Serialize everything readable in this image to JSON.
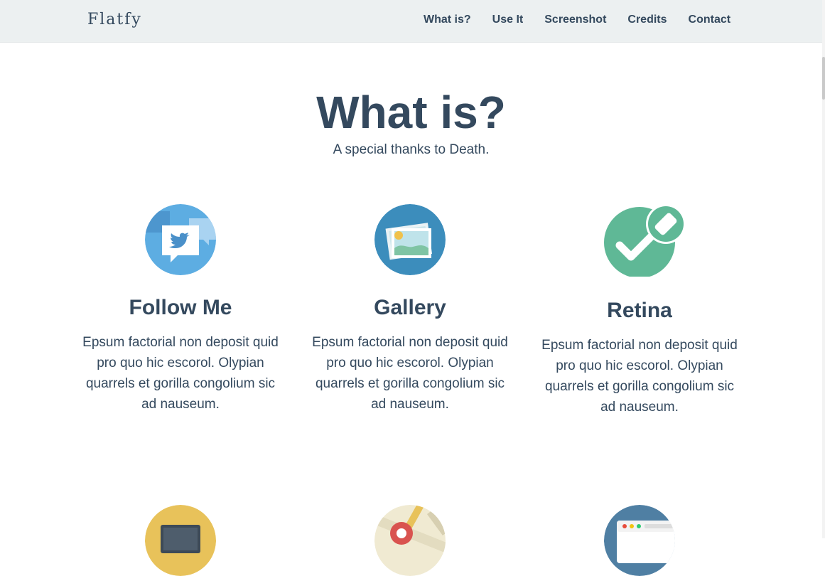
{
  "header": {
    "brand": "Flatfy",
    "nav": [
      "What is?",
      "Use It",
      "Screenshot",
      "Credits",
      "Contact"
    ]
  },
  "section": {
    "title": "What is?",
    "subtitle": "A special thanks to Death."
  },
  "features": [
    {
      "icon": "twitter-bubble-icon",
      "title": "Follow Me",
      "text": "Epsum factorial non deposit quid pro quo hic escorol. Olypian quarrels et gorilla congolium sic ad nauseum."
    },
    {
      "icon": "gallery-photo-icon",
      "title": "Gallery",
      "text": "Epsum factorial non deposit quid pro quo hic escorol. Olypian quarrels et gorilla congolium sic ad nauseum."
    },
    {
      "icon": "checkmark-eraser-icon",
      "title": "Retina",
      "text": "Epsum factorial non deposit quid pro quo hic escorol. Olypian quarrels et gorilla congolium sic ad nauseum."
    }
  ],
  "features_row2_icons": [
    "monitor-icon",
    "map-pin-icon",
    "browser-window-icon"
  ],
  "colors": {
    "nav_bg": "#ecf0f1",
    "text": "#34495e",
    "twitter_blue": "#5dade2",
    "gallery_blue": "#3c8dbc",
    "retina_green": "#5fb896",
    "yellow": "#e8c25a",
    "map_beige": "#f0ead2",
    "browser_blue": "#4f7fa3"
  }
}
